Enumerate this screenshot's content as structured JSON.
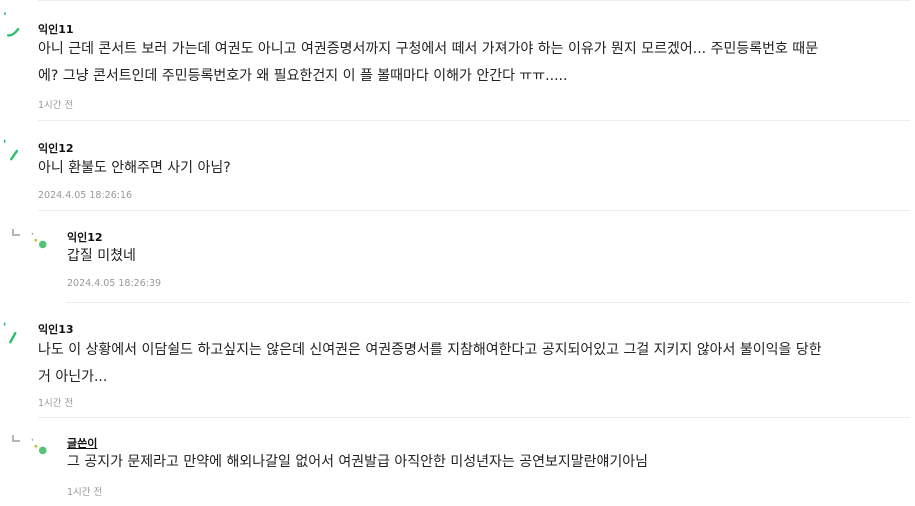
{
  "colors": {
    "avatar_green": "#2dbd6e",
    "avatar_lime": "#a6d12a",
    "separator": "#ececec",
    "meta_gray": "#999999"
  },
  "comments": [
    {
      "author": "익인11",
      "text_line1": "아니 근데 콘서트 보러 가는데 여권도 아니고 여권증명서까지 구청에서 떼서 가져가야 하는 이유가 뭔지 모르겠어... 주민등록번호 때문",
      "text_line2": "에? 그냥 콘서트인데 주민등록번호가 왜 필요한건지 이 플 볼때마다 이해가 안간다 ㅠㅠ.....",
      "time": "1시간 전",
      "avatar_icon": "green-swoosh-icon"
    },
    {
      "author": "익인12",
      "text_line1": "아니 환불도 안해주면 사기 아님?",
      "time": "2024.4.05 18:26:16",
      "avatar_icon": "green-slash-icon"
    },
    {
      "author": "익인12",
      "text_line1": "갑질 미쳤네",
      "time": "2024.4.05 18:26:39",
      "avatar_icon": "green-dot-icon",
      "reply_icon": "reply-arrow-icon"
    },
    {
      "author": "익인13",
      "text_line1": "나도 이 상황에서 이담쉴드 하고싶지는 않은데 신여권은 여권증명서를 지참해여한다고 공지되어있고 그걸 지키지 않아서 불이익을 당한",
      "text_line2": "거 아닌가...",
      "time": "1시간 전",
      "avatar_icon": "green-slash-icon"
    },
    {
      "author": "글쓴이",
      "text_line1": "그 공지가 문제라고 만약에 해외나갈일 없어서 여권발급 아직안한 미성년자는 공연보지말란얘기아님",
      "time": "1시간 전",
      "avatar_icon": "green-dot-icon",
      "reply_icon": "reply-arrow-icon"
    }
  ]
}
